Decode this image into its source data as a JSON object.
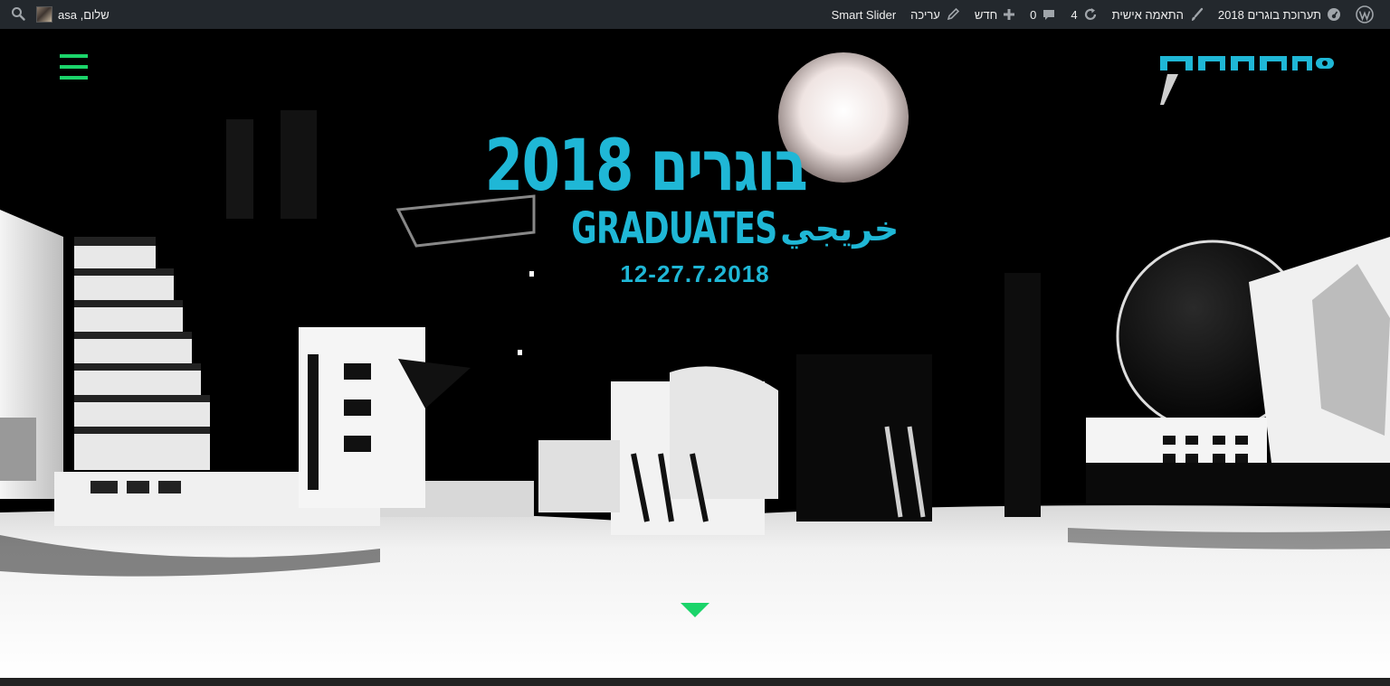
{
  "admin_bar": {
    "wp_logo_icon": "wordpress-icon",
    "site_name": "תערוכת בוגרים 2018",
    "customize_label": "התאמה אישית",
    "updates_count": "4",
    "comments_count": "0",
    "new_label": "חדש",
    "edit_label": "עריכה",
    "smart_slider_label": "Smart Slider",
    "greeting": "שלום, asa"
  },
  "hero": {
    "title_hebrew": "בוגרים 2018",
    "title_english": "GRADUATES",
    "title_arabic": "خريجي",
    "dates": "12-27.7.2018"
  },
  "header": {
    "logo_name": "musrara-logo",
    "menu_icon": "hamburger-menu-icon"
  },
  "colors": {
    "admin_bar_bg": "#23282d",
    "accent_cyan": "#1fb7d6",
    "accent_green": "#1bd46a",
    "hero_bg": "#000000"
  }
}
